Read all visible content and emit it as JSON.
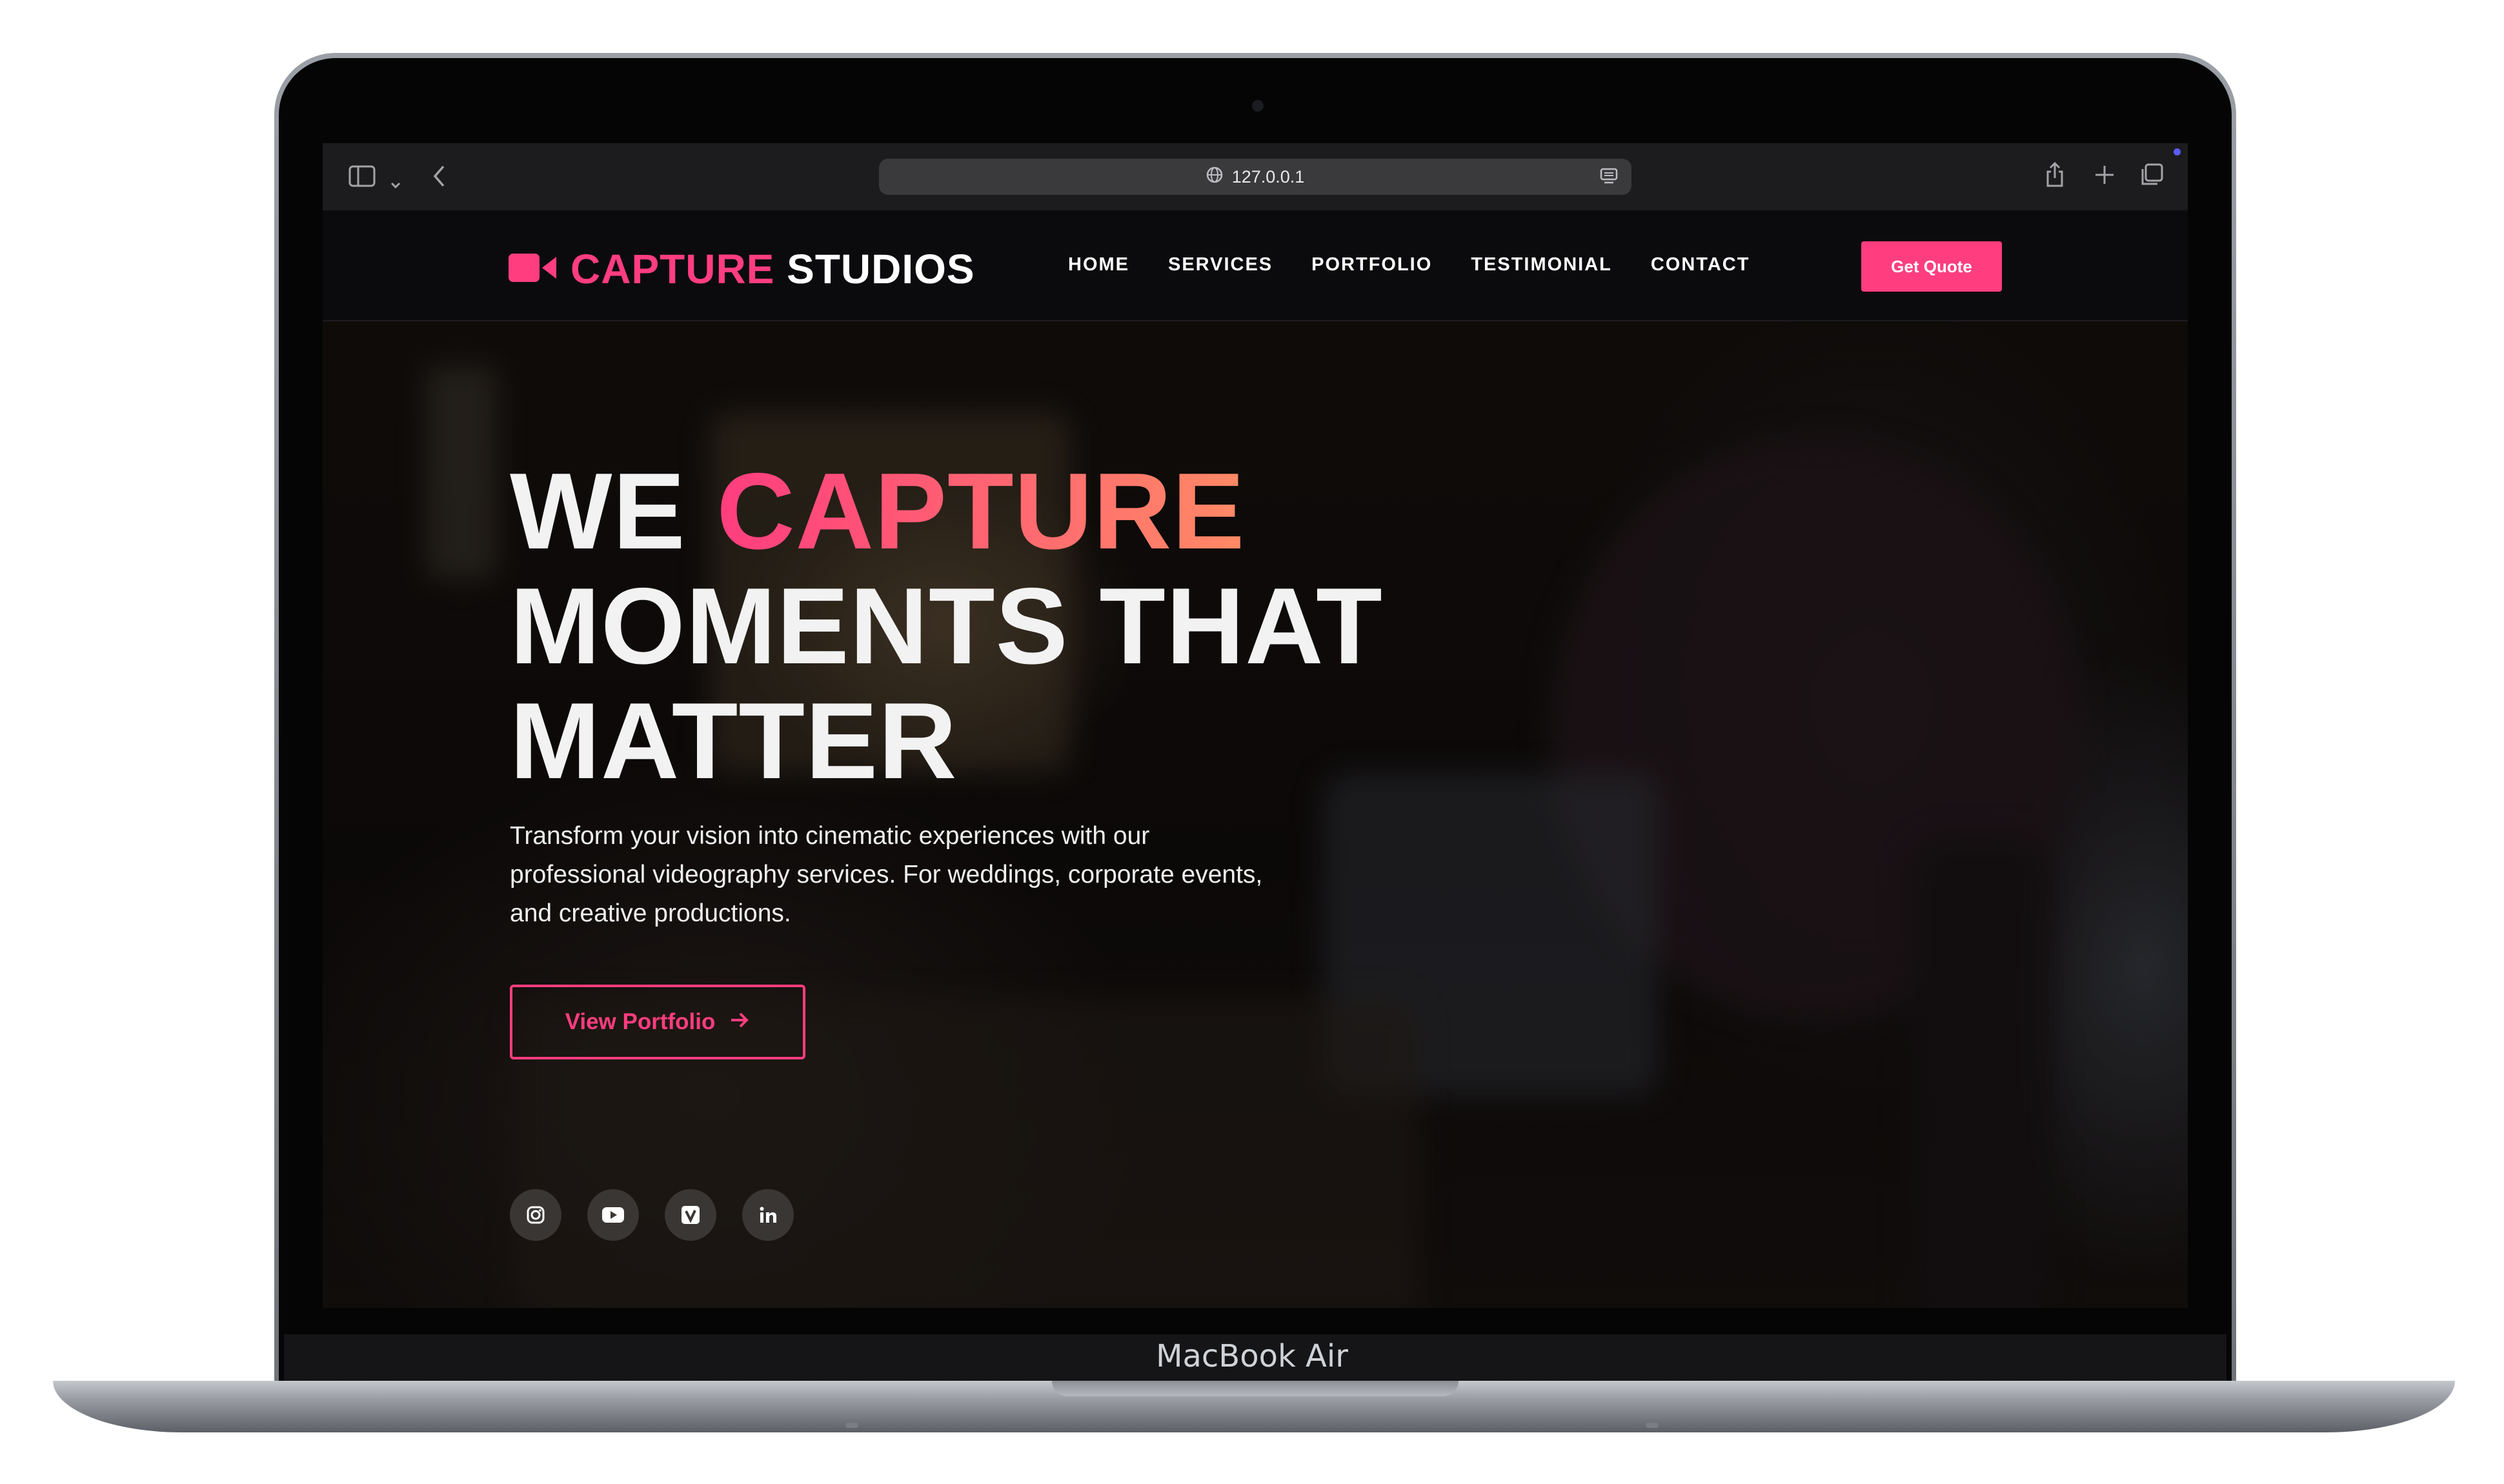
{
  "device": {
    "label": "MacBook Air"
  },
  "browser": {
    "url": "127.0.0.1",
    "icons": [
      "sidebar-icon",
      "chevron-down-icon",
      "back-icon",
      "globe-icon",
      "reader-icon",
      "share-icon",
      "new-tab-icon",
      "tabs-icon"
    ]
  },
  "site": {
    "brand": {
      "part1": "CAPTURE",
      "part2": "STUDIOS",
      "icon": "video-camera-icon"
    },
    "nav": [
      "HOME",
      "SERVICES",
      "PORTFOLIO",
      "TESTIMONIAL",
      "CONTACT"
    ],
    "cta": "Get Quote",
    "hero": {
      "line1_a": "WE",
      "line1_b": "CAPTURE",
      "line2": "MOMENTS THAT",
      "line3": "MATTER",
      "subtext": "Transform your vision into cinematic experiences with our professional videography services. For weddings, corporate events, and creative productions.",
      "button": "View Portfolio",
      "button_icon": "arrow-right-icon"
    },
    "socials": [
      "instagram-icon",
      "youtube-icon",
      "vimeo-icon",
      "linkedin-icon"
    ]
  },
  "colors": {
    "accent": "#ff3d7f",
    "accent_end": "#ff8a65",
    "background": "#0a0a0c"
  }
}
